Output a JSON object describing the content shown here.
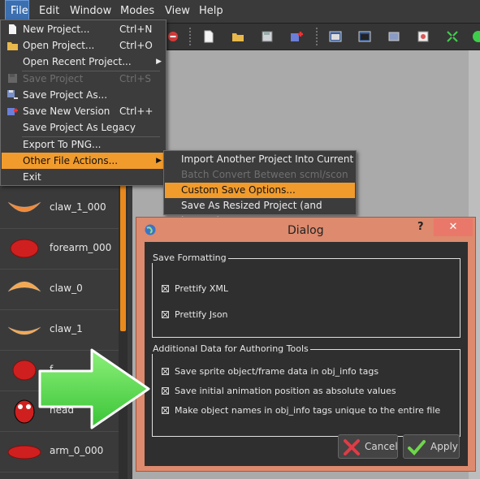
{
  "menubar": {
    "items": [
      "File",
      "Edit",
      "Window",
      "Modes",
      "View",
      "Help"
    ]
  },
  "file_menu": {
    "items": [
      {
        "label": "New Project...",
        "shortcut": "Ctrl+N",
        "icon": "new-page-icon",
        "enabled": true
      },
      {
        "label": "Open Project...",
        "shortcut": "Ctrl+O",
        "icon": "folder-icon",
        "enabled": true
      },
      {
        "label": "Open Recent Project...",
        "shortcut": "",
        "icon": "",
        "enabled": true,
        "submenu": true
      },
      {
        "label": "Save Project",
        "shortcut": "Ctrl+S",
        "icon": "save-disk-icon",
        "enabled": false
      },
      {
        "label": "Save Project As...",
        "shortcut": "",
        "icon": "save-as-icon",
        "enabled": true
      },
      {
        "label": "Save New Version",
        "shortcut": "Ctrl++",
        "icon": "save-version-icon",
        "enabled": true
      },
      {
        "label": "Save Project As Legacy",
        "shortcut": "",
        "icon": "",
        "enabled": true
      },
      {
        "label": "Export To PNG...",
        "shortcut": "",
        "icon": "",
        "enabled": true
      },
      {
        "label": "Other File Actions...",
        "shortcut": "",
        "icon": "",
        "enabled": true,
        "submenu": true,
        "highlighted": true
      },
      {
        "label": "Exit",
        "shortcut": "",
        "icon": "",
        "enabled": true
      }
    ]
  },
  "submenu": {
    "items": [
      {
        "label": "Import Another Project Into Current",
        "enabled": true
      },
      {
        "label": "Batch Convert Between scml/scon",
        "enabled": false
      },
      {
        "label": "Custom Save Options...",
        "enabled": true,
        "highlighted": true
      },
      {
        "label": "Save As Resized Project (and images)",
        "enabled": true
      }
    ]
  },
  "sprites": {
    "items": [
      "claw_1_000",
      "forearm_000",
      "claw_0",
      "claw_1",
      "f...",
      "head",
      "arm_0_000"
    ]
  },
  "dialog": {
    "title": "Dialog",
    "help": "?",
    "close": "✕",
    "group1": {
      "title": "Save Formatting",
      "options": [
        "Prettify XML",
        "Prettify Json"
      ]
    },
    "group2": {
      "title": "Additional Data for Authoring Tools",
      "options": [
        "Save sprite object/frame data in obj_info tags",
        "Save initial animation position as absolute values",
        "Make object names in obj_info tags unique to the entire file"
      ]
    },
    "cancel_label": "Cancel",
    "apply_label": "Apply"
  },
  "colors": {
    "menu_highlight": "#f19b2c",
    "dialog_frame": "#dd8a6e",
    "arrow_green": "#5fe05a"
  }
}
